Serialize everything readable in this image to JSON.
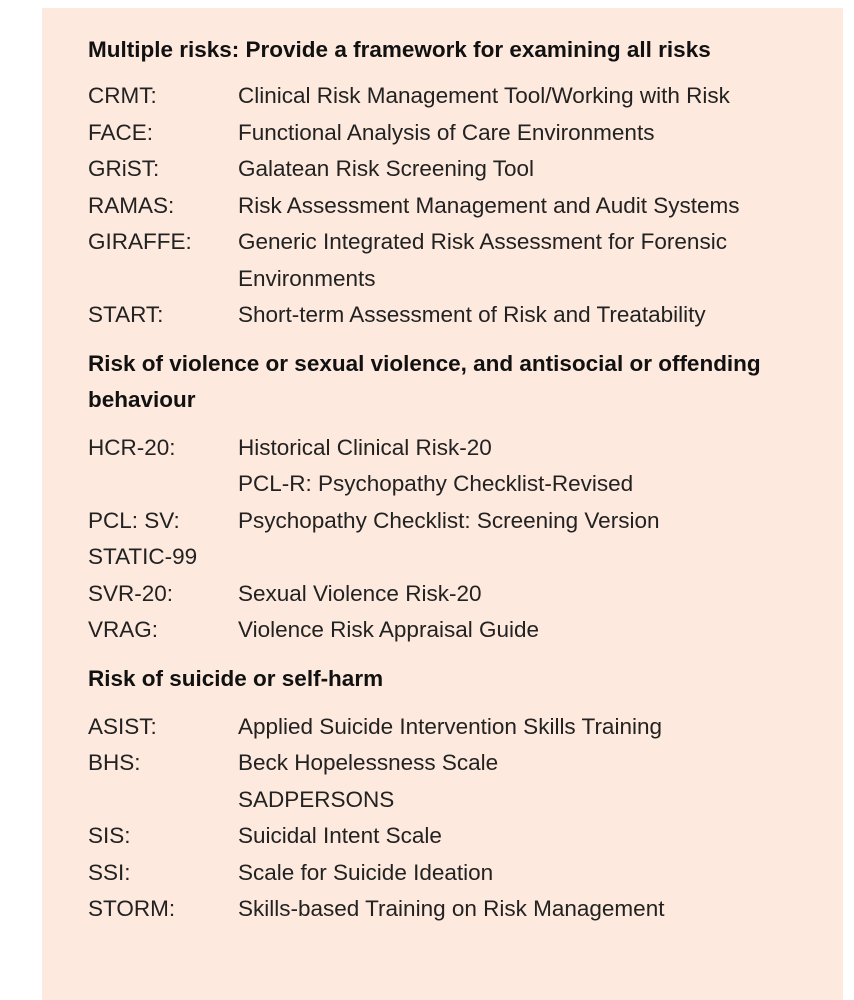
{
  "sections": [
    {
      "heading": "Multiple risks:  Provide a framework for examining all risks",
      "items": [
        {
          "abbr": "CRMT:",
          "desc": "Clinical Risk Management Tool/Working with Risk"
        },
        {
          "abbr": "FACE:",
          "desc": "Functional Analysis of Care Environments"
        },
        {
          "abbr": "GRiST:",
          "desc": "Galatean Risk Screening Tool"
        },
        {
          "abbr": "RAMAS:",
          "desc": "Risk Assessment Management and Audit Systems"
        },
        {
          "abbr": "GIRAFFE:",
          "desc": "Generic Integrated Risk Assessment for Forensic Environments"
        },
        {
          "abbr": "START:",
          "desc": "Short-term Assessment of Risk and Treatability"
        }
      ]
    },
    {
      "heading": "Risk of violence or sexual violence, and antisocial or offending behaviour",
      "items": [
        {
          "abbr": "HCR-20:",
          "desc": "Historical Clinical Risk-20"
        },
        {
          "abbr": "",
          "desc": "PCL-R: Psychopathy Checklist-Revised"
        },
        {
          "abbr": "PCL: SV:",
          "desc": "Psychopathy Checklist: Screening Version"
        },
        {
          "abbr": "STATIC-99",
          "desc": ""
        },
        {
          "abbr": "SVR-20:",
          "desc": "Sexual Violence Risk-20"
        },
        {
          "abbr": "VRAG:",
          "desc": "Violence Risk Appraisal Guide"
        }
      ]
    },
    {
      "heading": "Risk of suicide or self-harm",
      "items": [
        {
          "abbr": "ASIST:",
          "desc": "Applied Suicide Intervention Skills Training"
        },
        {
          "abbr": "BHS:",
          "desc": "Beck Hopelessness Scale"
        },
        {
          "abbr": "",
          "desc": "SADPERSONS"
        },
        {
          "abbr": "SIS:",
          "desc": "Suicidal Intent Scale"
        },
        {
          "abbr": "SSI:",
          "desc": "Scale for Suicide Ideation"
        },
        {
          "abbr": "STORM:",
          "desc": "Skills-based Training on Risk Management"
        }
      ]
    }
  ]
}
